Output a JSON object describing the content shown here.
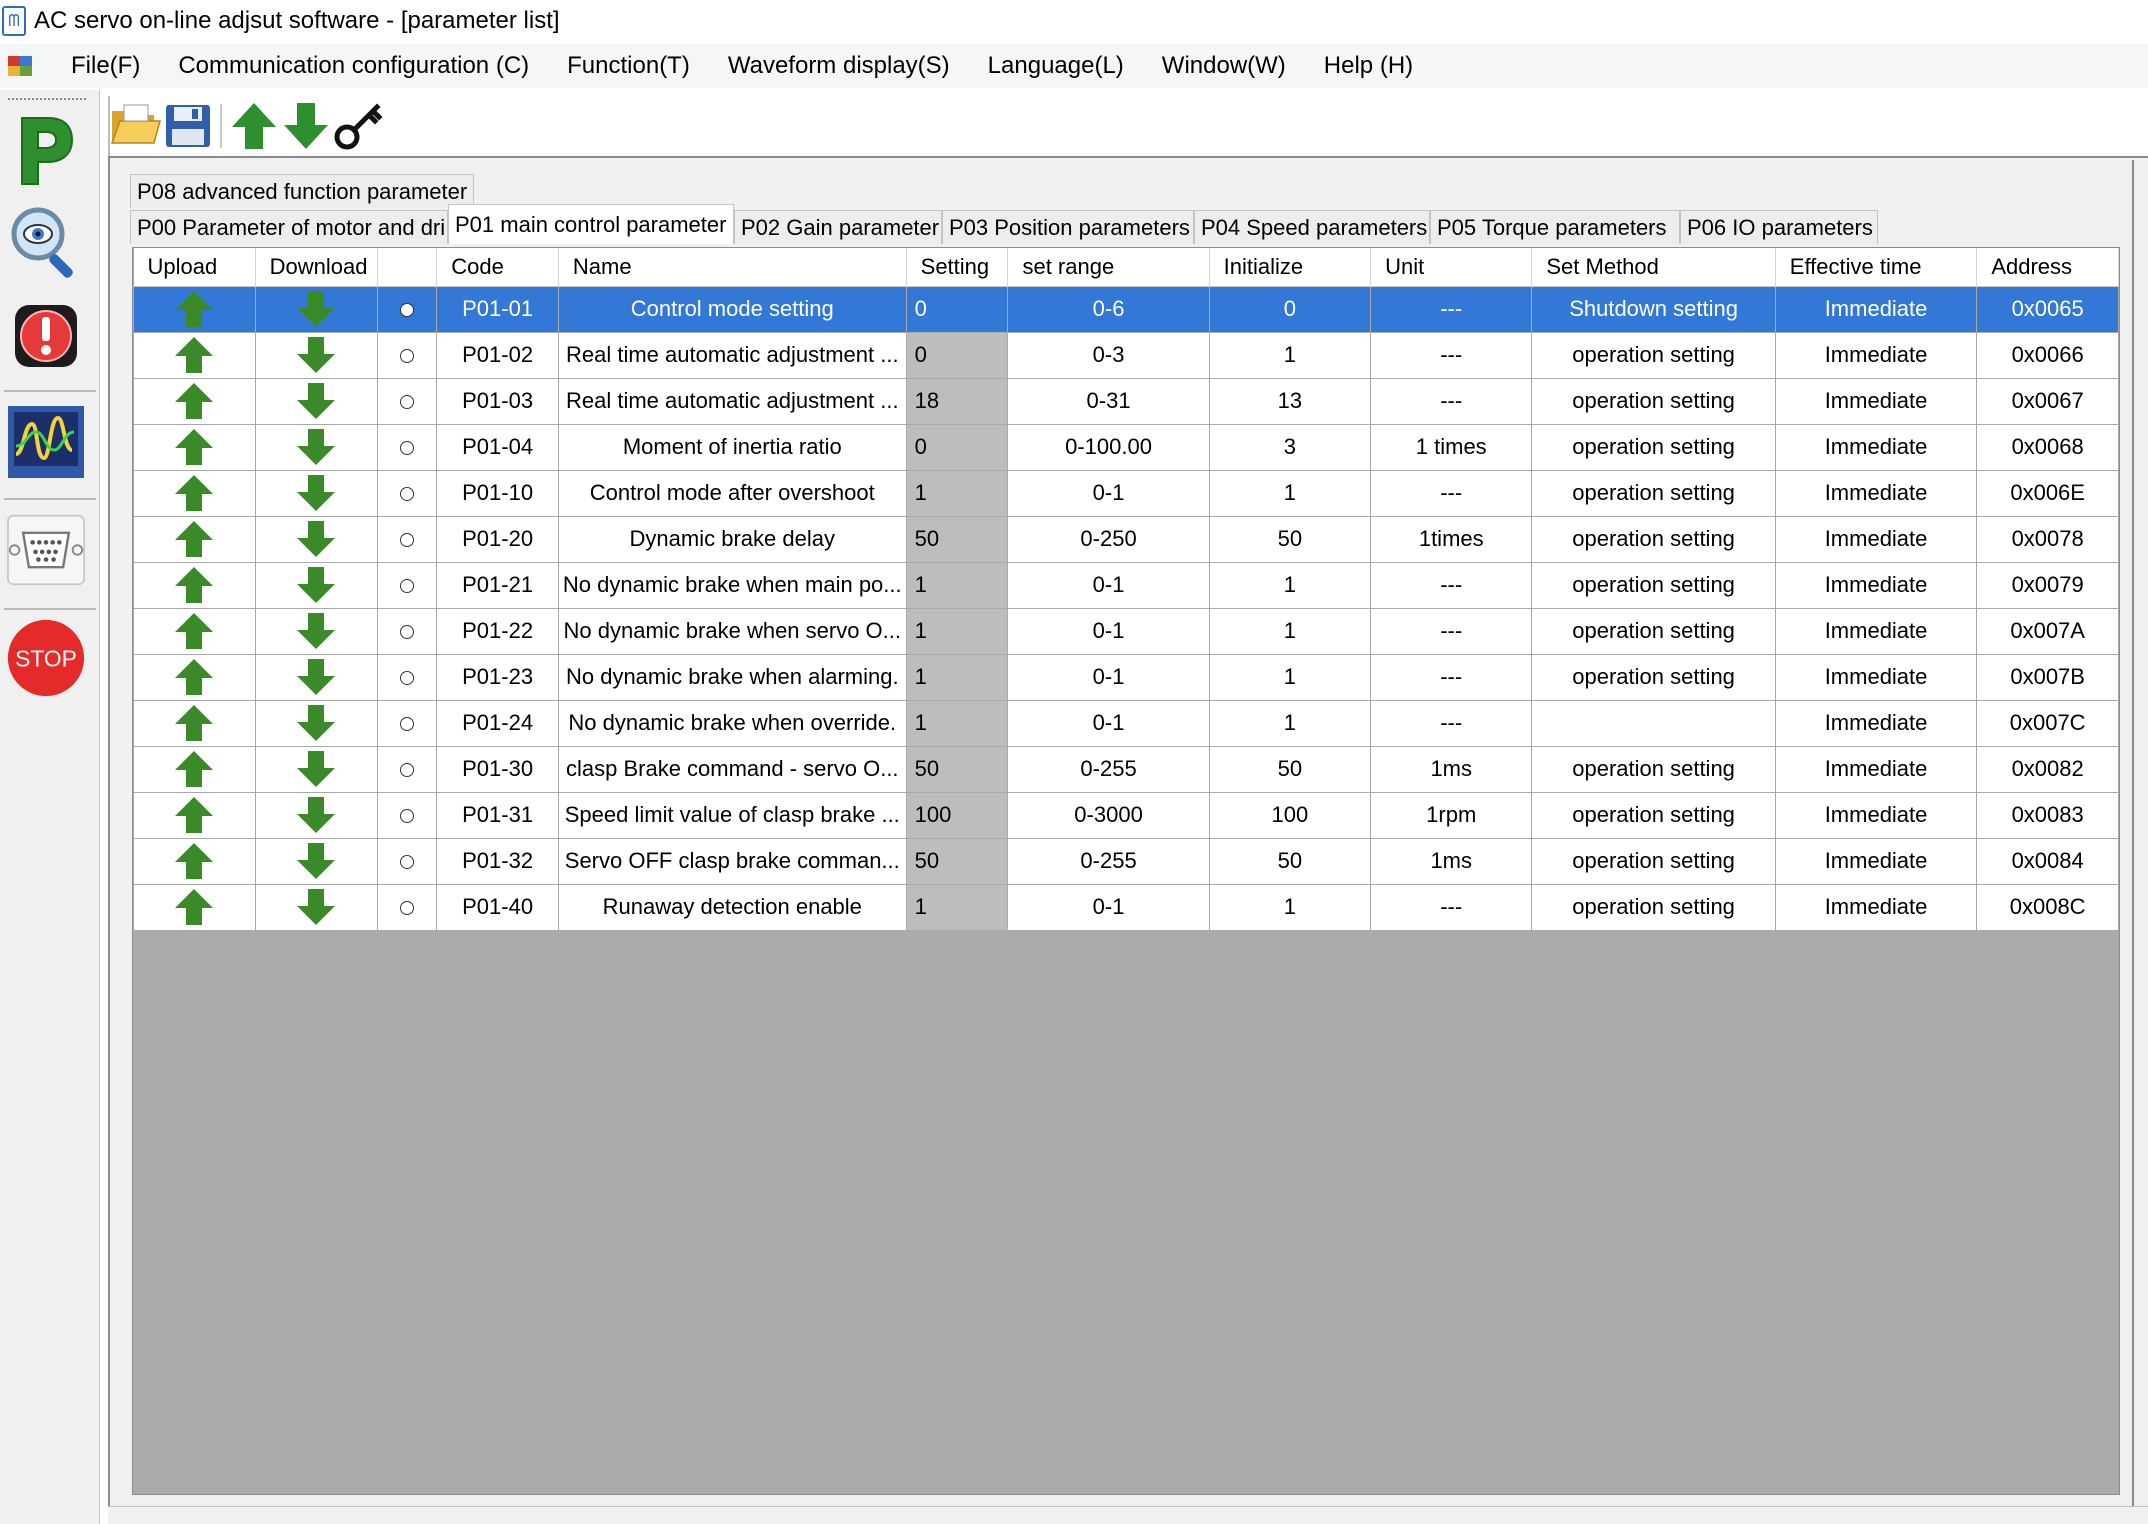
{
  "window": {
    "title": "AC servo on-line adjsut software - [parameter list]",
    "icon": "app-icon"
  },
  "menu": {
    "items": [
      "File(F)",
      "Communication configuration (C)",
      "Function(T)",
      "Waveform display(S)",
      "Language(L)",
      "Window(W)",
      "Help (H)"
    ]
  },
  "left_tools": [
    {
      "icon": "parameter-p-icon",
      "label": "P"
    },
    {
      "icon": "monitor-magnifier-icon"
    },
    {
      "icon": "alarm-icon"
    },
    {
      "icon": "oscilloscope-icon"
    },
    {
      "icon": "serial-port-icon"
    },
    {
      "icon": "stop-icon",
      "label": "STOP"
    }
  ],
  "toolbar": {
    "buttons": [
      "open-folder-icon",
      "save-disk-icon",
      "upload-arrow-icon",
      "download-arrow-icon",
      "key-icon"
    ]
  },
  "tabs": {
    "row1": [
      "P08 advanced function parameter"
    ],
    "row2": [
      "P00  Parameter of motor and dri",
      "P01 main control parameter",
      "P02 Gain parameter",
      "P03 Position parameters",
      "P04 Speed parameters",
      "P05 Torque parameters",
      "P06 IO parameters"
    ],
    "active": "P01 main control parameter"
  },
  "grid": {
    "columns": [
      "Upload",
      "Download",
      "",
      "Code",
      "Name",
      "Setting",
      "set range",
      "Initialize",
      "Unit",
      "Set Method",
      "Effective time",
      "Address"
    ],
    "selected_row": 0,
    "rows": [
      {
        "code": "P01-01",
        "name": "Control mode setting",
        "setting": "0",
        "range": "0-6",
        "init": "0",
        "unit": "---",
        "method": "Shutdown setting",
        "effective": "Immediate",
        "address": "0x0065"
      },
      {
        "code": "P01-02",
        "name": "Real time automatic adjustment ...",
        "setting": "0",
        "range": "0-3",
        "init": "1",
        "unit": "---",
        "method": "operation setting",
        "effective": "Immediate",
        "address": "0x0066"
      },
      {
        "code": "P01-03",
        "name": "Real time automatic adjustment ...",
        "setting": "18",
        "range": "0-31",
        "init": "13",
        "unit": "---",
        "method": "operation setting",
        "effective": "Immediate",
        "address": "0x0067"
      },
      {
        "code": "P01-04",
        "name": "Moment of inertia ratio",
        "setting": "0",
        "range": "0-100.00",
        "init": "3",
        "unit": "1 times",
        "method": "operation setting",
        "effective": "Immediate",
        "address": "0x0068"
      },
      {
        "code": "P01-10",
        "name": "Control mode after overshoot",
        "setting": "1",
        "range": "0-1",
        "init": "1",
        "unit": "---",
        "method": "operation setting",
        "effective": "Immediate",
        "address": "0x006E"
      },
      {
        "code": "P01-20",
        "name": "Dynamic brake delay",
        "setting": "50",
        "range": "0-250",
        "init": "50",
        "unit": "1times",
        "method": "operation setting",
        "effective": "Immediate",
        "address": "0x0078"
      },
      {
        "code": "P01-21",
        "name": "No dynamic brake when main po...",
        "setting": "1",
        "range": "0-1",
        "init": "1",
        "unit": "---",
        "method": "operation setting",
        "effective": "Immediate",
        "address": "0x0079"
      },
      {
        "code": "P01-22",
        "name": "No dynamic brake when servo O...",
        "setting": "1",
        "range": "0-1",
        "init": "1",
        "unit": "---",
        "method": "operation setting",
        "effective": "Immediate",
        "address": "0x007A"
      },
      {
        "code": "P01-23",
        "name": "No dynamic brake when alarming.",
        "setting": "1",
        "range": "0-1",
        "init": "1",
        "unit": "---",
        "method": "operation setting",
        "effective": "Immediate",
        "address": "0x007B"
      },
      {
        "code": "P01-24",
        "name": "No dynamic brake when override.",
        "setting": "1",
        "range": "0-1",
        "init": "1",
        "unit": "---",
        "method": "",
        "effective": "Immediate",
        "address": "0x007C"
      },
      {
        "code": "P01-30",
        "name": "clasp Brake command - servo O...",
        "setting": "50",
        "range": "0-255",
        "init": "50",
        "unit": "1ms",
        "method": "operation setting",
        "effective": "Immediate",
        "address": "0x0082"
      },
      {
        "code": "P01-31",
        "name": "Speed limit value of clasp brake ...",
        "setting": "100",
        "range": "0-3000",
        "init": "100",
        "unit": "1rpm",
        "method": "operation setting",
        "effective": "Immediate",
        "address": "0x0083"
      },
      {
        "code": "P01-32",
        "name": "Servo OFF clasp brake comman...",
        "setting": "50",
        "range": "0-255",
        "init": "50",
        "unit": "1ms",
        "method": "operation setting",
        "effective": "Immediate",
        "address": "0x0084"
      },
      {
        "code": "P01-40",
        "name": "Runaway detection enable",
        "setting": "1",
        "range": "0-1",
        "init": "1",
        "unit": "---",
        "method": "operation setting",
        "effective": "Immediate",
        "address": "0x008C"
      }
    ]
  },
  "colors": {
    "selected_row": "#3378d6",
    "setting_cell": "#bdbdbd",
    "grid_background": "#ababab",
    "arrow_green": "#3a8a2a",
    "stop_red": "#e02a2a"
  }
}
